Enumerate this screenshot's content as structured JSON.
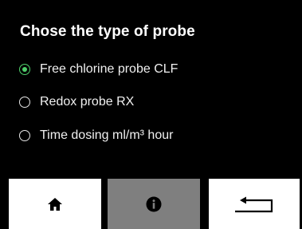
{
  "screen": {
    "title": "Chose the type of probe",
    "options": [
      {
        "label": "Free chlorine probe CLF",
        "selected": true
      },
      {
        "label": "Redox probe RX",
        "selected": false
      },
      {
        "label": "Time dosing ml/m³ hour",
        "selected": false
      }
    ],
    "colors": {
      "background": "#000000",
      "selected_radio": "#4fd06b",
      "button_light": "#ffffff",
      "button_active": "#7f7f7f"
    }
  },
  "bottom_bar": {
    "buttons": [
      {
        "icon": "home-icon"
      },
      {
        "icon": "info-icon"
      },
      {
        "icon": "back-arrow-icon"
      }
    ]
  }
}
